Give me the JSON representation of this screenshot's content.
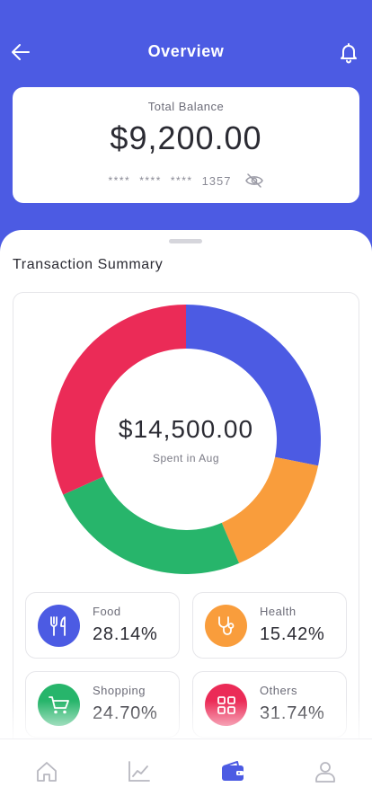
{
  "header": {
    "title": "Overview",
    "back_icon": "arrow-left-icon",
    "notification_icon": "bell-icon",
    "background": "#4c5be3"
  },
  "balance": {
    "label": "Total Balance",
    "amount": "$9,200.00",
    "card_mask": [
      "****",
      "****",
      "****"
    ],
    "card_last4": "1357",
    "visibility_icon": "eye-off-icon"
  },
  "summary": {
    "title": "Transaction Summary",
    "total": "$14,500.00",
    "subtitle": "Spent in Aug",
    "categories": [
      {
        "name": "Food",
        "percent": "28.14%",
        "color": "#4c5be3",
        "icon": "fork-knife-icon"
      },
      {
        "name": "Health",
        "percent": "15.42%",
        "color": "#f99d3c",
        "icon": "stethoscope-icon"
      },
      {
        "name": "Shopping",
        "percent": "24.70%",
        "color": "#27b56b",
        "icon": "shopping-cart-icon"
      },
      {
        "name": "Others",
        "percent": "31.74%",
        "color": "#eb2b57",
        "icon": "grid-icon"
      }
    ]
  },
  "chart_data": {
    "type": "pie",
    "categories": [
      "Food",
      "Health",
      "Shopping",
      "Others"
    ],
    "values": [
      28.14,
      15.42,
      24.7,
      31.74
    ],
    "colors": [
      "#4c5be3",
      "#f99d3c",
      "#27b56b",
      "#eb2b57"
    ],
    "title": "",
    "center_label": "$14,500.00",
    "center_sublabel": "Spent in Aug",
    "donut": true
  },
  "bottom_nav": [
    {
      "icon": "home-icon",
      "active": false
    },
    {
      "icon": "chart-icon",
      "active": false
    },
    {
      "icon": "wallet-icon",
      "active": true
    },
    {
      "icon": "profile-icon",
      "active": false
    }
  ]
}
